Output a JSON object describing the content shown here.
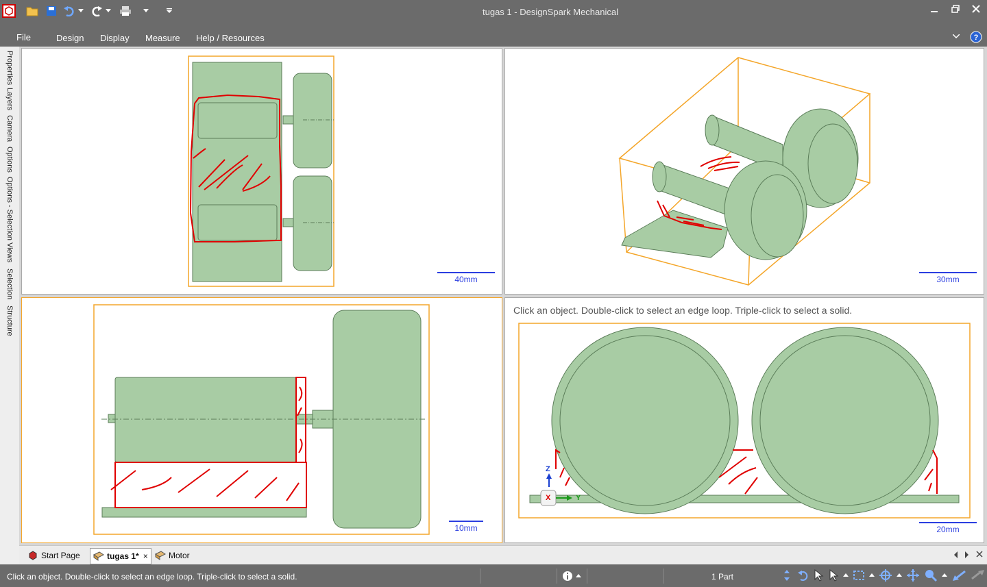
{
  "window": {
    "title": "tugas 1 - DesignSpark Mechanical",
    "minimize_icon": "minimize-icon",
    "restore_icon": "restore-icon",
    "close_icon": "close-icon"
  },
  "quick_access": [
    "app-logo-icon",
    "open-folder-icon",
    "save-icon",
    "undo-icon",
    "redo-icon",
    "print-icon",
    "customize-qat-icon"
  ],
  "menu": {
    "items": [
      "File",
      "Design",
      "Display",
      "Measure",
      "Help / Resources"
    ]
  },
  "side_panels": [
    "Properties",
    "Layers",
    "Camera",
    "Options",
    "Options - Selection",
    "Views",
    "Selection",
    "Structure"
  ],
  "viewports": {
    "top_left": {
      "scale": "40mm"
    },
    "top_right": {
      "scale": "30mm"
    },
    "bottom_left": {
      "scale": "10mm"
    },
    "bottom_right": {
      "scale": "20mm",
      "hint": "Click an object. Double-click to select an edge loop. Triple-click to select a solid.",
      "axes": {
        "z": "Z",
        "x": "X",
        "y": "Y"
      }
    }
  },
  "doc_tabs": [
    {
      "label": "Start Page",
      "icon": "start-page-icon"
    },
    {
      "label": "tugas 1*",
      "icon": "design-icon",
      "close": "×"
    },
    {
      "label": "Motor",
      "icon": "design-icon"
    }
  ],
  "status": {
    "message": "Click an object. Double-click to select an edge loop. Triple-click to select a solid.",
    "info_icon": "info-icon",
    "parts": "1 Part"
  },
  "colors": {
    "chrome": "#6b6b6b",
    "model_fill": "#a8cca4",
    "model_stroke": "#5b7d59",
    "selection_box": "#f4a62a",
    "markup": "#e00000",
    "scale": "#2b3ee0"
  }
}
